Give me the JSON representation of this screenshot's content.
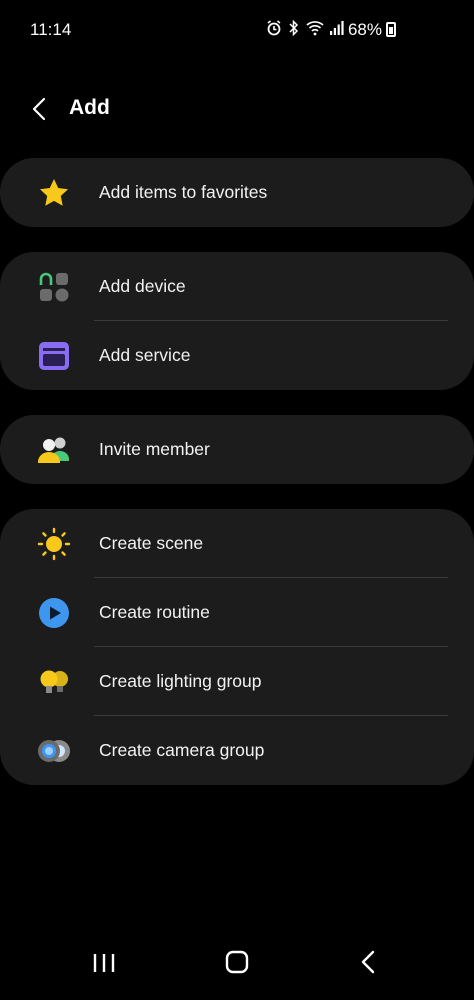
{
  "status_bar": {
    "time": "11:14",
    "battery": "68%"
  },
  "header": {
    "title": "Add"
  },
  "groups": {
    "favorites": {
      "items": [
        {
          "label": "Add items to favorites",
          "icon": "star-icon"
        }
      ]
    },
    "devices": {
      "items": [
        {
          "label": "Add device",
          "icon": "device-icon"
        },
        {
          "label": "Add service",
          "icon": "service-icon"
        }
      ]
    },
    "members": {
      "items": [
        {
          "label": "Invite member",
          "icon": "members-icon"
        }
      ]
    },
    "automation": {
      "items": [
        {
          "label": "Create scene",
          "icon": "sun-icon"
        },
        {
          "label": "Create routine",
          "icon": "play-icon"
        },
        {
          "label": "Create lighting group",
          "icon": "bulb-icon"
        },
        {
          "label": "Create camera group",
          "icon": "camera-icon"
        }
      ]
    }
  },
  "colors": {
    "background": "#000000",
    "card": "#1c1c1c",
    "divider": "#3a3a3a",
    "star": "#f8c91b",
    "device_accent": "#4ac87a",
    "service": "#8a6cf2",
    "routine": "#3d97ee",
    "sun": "#f8c91b"
  }
}
